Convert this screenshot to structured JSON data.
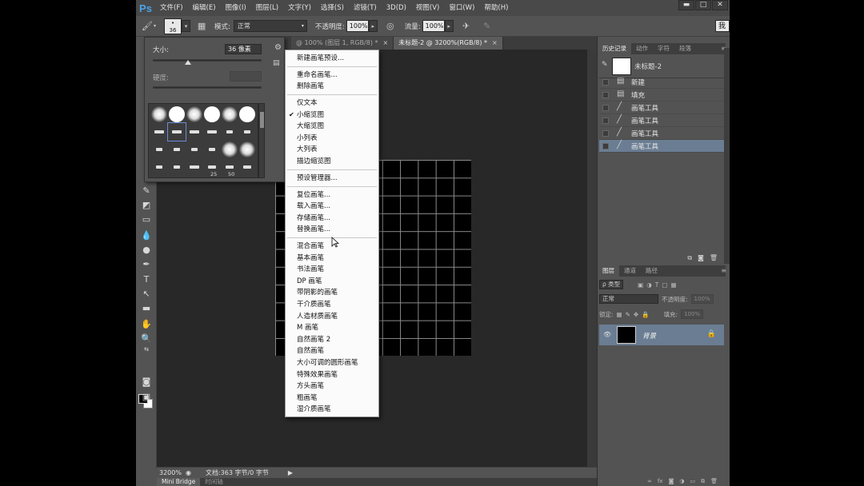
{
  "app": {
    "logo": "Ps"
  },
  "menu": [
    "文件(F)",
    "编辑(E)",
    "图像(I)",
    "图层(L)",
    "文字(Y)",
    "选择(S)",
    "滤镜(T)",
    "3D(D)",
    "视图(V)",
    "窗口(W)",
    "帮助(H)"
  ],
  "window_controls": {
    "minimize": "▬",
    "maximize": "□",
    "close": "✕"
  },
  "options": {
    "brush_size": "36",
    "mode_label": "模式:",
    "mode_value": "正常",
    "opacity_label": "不透明度:",
    "opacity_value": "100%",
    "flow_label": "流量:",
    "flow_value": "100%",
    "right_button": "我"
  },
  "doc_tabs": [
    {
      "label": "@ 100% (图层 1, RGB/8) *",
      "close": "×"
    },
    {
      "label": "未标题-2 @ 3200%(RGB/8) *",
      "close": "×"
    }
  ],
  "brush_panel": {
    "size_label": "大小:",
    "size_value": "36 像素",
    "hardness_label": "硬度:",
    "nums": [
      "25",
      "50"
    ]
  },
  "dropdown": {
    "groups": [
      [
        "新建画笔预设..."
      ],
      [
        "重命名画笔...",
        "删除画笔"
      ],
      [
        "仅文本",
        "小缩览图",
        "大缩览图",
        "小列表",
        "大列表",
        "描边缩览图"
      ],
      [
        "预设管理器..."
      ],
      [
        "复位画笔...",
        "载入画笔...",
        "存储画笔...",
        "替换画笔..."
      ],
      [
        "混合画笔",
        "基本画笔",
        "书法画笔",
        "DP 画笔",
        "带阴影的画笔",
        "干介质画笔",
        "人造材质画笔",
        "M 画笔",
        "自然画笔 2",
        "自然画笔",
        "大小可调的圆形画笔",
        "特殊效果画笔",
        "方头画笔",
        "粗画笔",
        "湿介质画笔"
      ]
    ],
    "checked": "小缩览图"
  },
  "history_panel": {
    "tabs": [
      "历史记录",
      "动作",
      "字符",
      "段落"
    ],
    "snapshot": "未标题-2",
    "items": [
      {
        "label": "新建",
        "icon": "doc-icon"
      },
      {
        "label": "填充",
        "icon": "fill-icon"
      },
      {
        "label": "画笔工具",
        "icon": "brush-icon"
      },
      {
        "label": "画笔工具",
        "icon": "brush-icon"
      },
      {
        "label": "画笔工具",
        "icon": "brush-icon"
      },
      {
        "label": "画笔工具",
        "icon": "brush-icon"
      }
    ],
    "selected_index": 5
  },
  "layers_panel": {
    "tabs": [
      "图层",
      "通道",
      "路径"
    ],
    "filter_label": "ρ 类型",
    "blend_mode": "正常",
    "opacity_label": "不透明度:",
    "opacity_value": "100%",
    "lock_label": "锁定:",
    "fill_label": "填充:",
    "fill_value": "100%",
    "layer_name": "背景"
  },
  "status": {
    "zoom": "3200%",
    "doc": "文档:363 字节/0 字节"
  },
  "bottom_tabs": [
    "Mini Bridge",
    "时间轴"
  ]
}
